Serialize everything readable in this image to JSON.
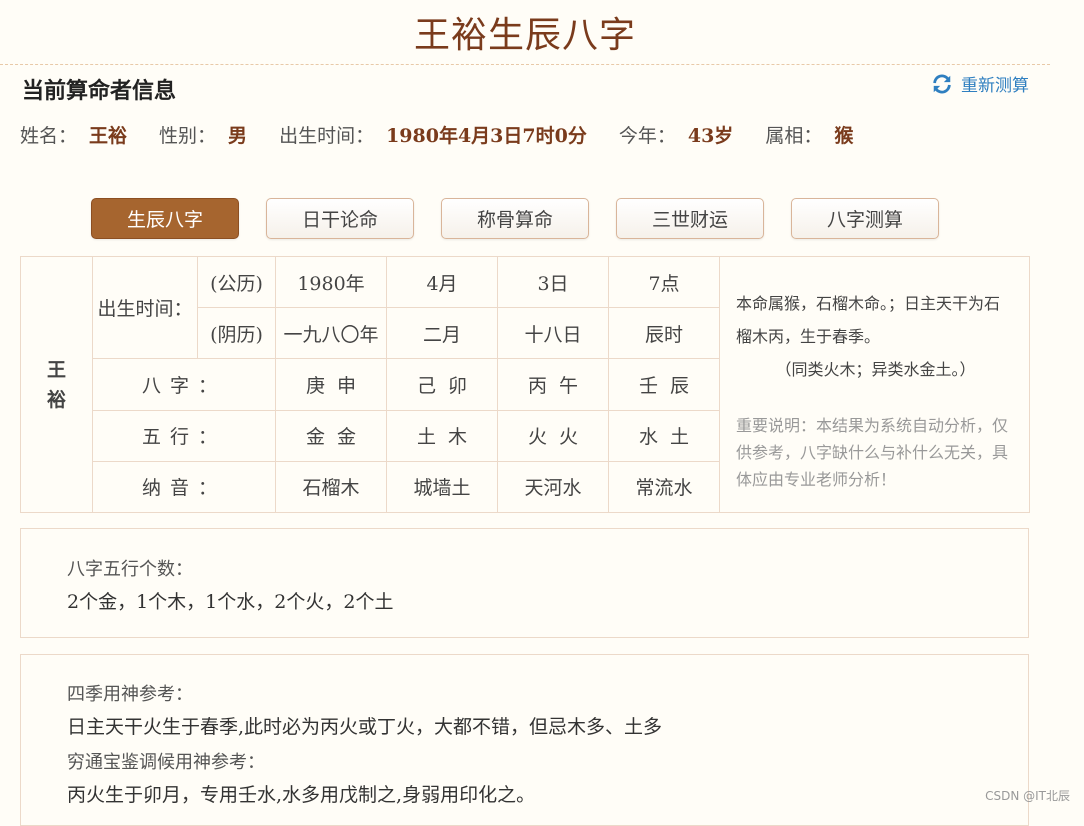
{
  "page": {
    "title": "王裕生辰八字"
  },
  "section": {
    "title": "当前算命者信息",
    "remeasure_label": "重新测算",
    "remeasure_icon": "refresh-icon"
  },
  "person": {
    "name_label": "姓名：",
    "name": "王裕",
    "gender_label": "性别：",
    "gender": "男",
    "birth_label": "出生时间：",
    "birth": "1980年4月3日7时0分",
    "age_label": "今年：",
    "age": "43岁",
    "zodiac_label": "属相：",
    "zodiac": "猴"
  },
  "tabs": [
    {
      "label": "生辰八字",
      "active": true
    },
    {
      "label": "日干论命",
      "active": false
    },
    {
      "label": "称骨算命",
      "active": false
    },
    {
      "label": "三世财运",
      "active": false
    },
    {
      "label": "八字测算",
      "active": false
    }
  ],
  "table": {
    "name_chars": [
      "王",
      "裕"
    ],
    "birth_label": "出生时间：",
    "solar_label": "(公历)",
    "lunar_label": "(阴历)",
    "solar": [
      "1980年",
      "4月",
      "3日",
      "7点"
    ],
    "lunar": [
      "一九八〇年",
      "二月",
      "十八日",
      "辰时"
    ],
    "bazi_label": "八字：",
    "bazi": [
      "庚申",
      "己卯",
      "丙午",
      "壬辰"
    ],
    "wuxing_label": "五行：",
    "wuxing": [
      "金金",
      "土木",
      "火火",
      "水土"
    ],
    "nayin_label": "纳音：",
    "nayin": [
      "石榴木",
      "城墙土",
      "天河水",
      "常流水"
    ],
    "note_main": "本命属猴，石榴木命。；日主天干为石榴木丙，生于春季。",
    "note_sub": "（同类火木；异类水金土。）",
    "note_important": "重要说明：本结果为系统自动分析，仅供参考，八字缺什么与补什么无关，具体应由专业老师分析！"
  },
  "wuxing_count": {
    "label": "八字五行个数：",
    "text": "2个金，1个木，1个水，2个火，2个土"
  },
  "yongshen": {
    "label1": "四季用神参考：",
    "text1": "日主天干火生于春季,此时必为丙火或丁火，大都不错，但忌木多、土多",
    "label2": "穷通宝鉴调候用神参考：",
    "text2": "丙火生于卯月，专用壬水,水多用戊制之,身弱用印化之。"
  },
  "watermark": "CSDN @IT北辰"
}
